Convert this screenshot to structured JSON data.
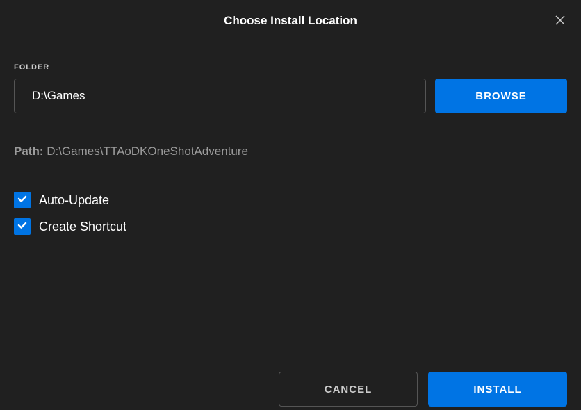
{
  "header": {
    "title": "Choose Install Location"
  },
  "folder": {
    "label": "FOLDER",
    "value": "D:\\Games",
    "browse_label": "BROWSE"
  },
  "path": {
    "label": "Path: ",
    "value": "D:\\Games\\TTAoDKOneShotAdventure"
  },
  "checkboxes": {
    "auto_update": {
      "label": "Auto-Update",
      "checked": true
    },
    "create_shortcut": {
      "label": "Create Shortcut",
      "checked": true
    }
  },
  "footer": {
    "cancel_label": "CANCEL",
    "install_label": "INSTALL"
  },
  "colors": {
    "accent": "#0074e4",
    "background": "#202020",
    "border": "#555555",
    "text_muted": "#9b9b9b"
  }
}
